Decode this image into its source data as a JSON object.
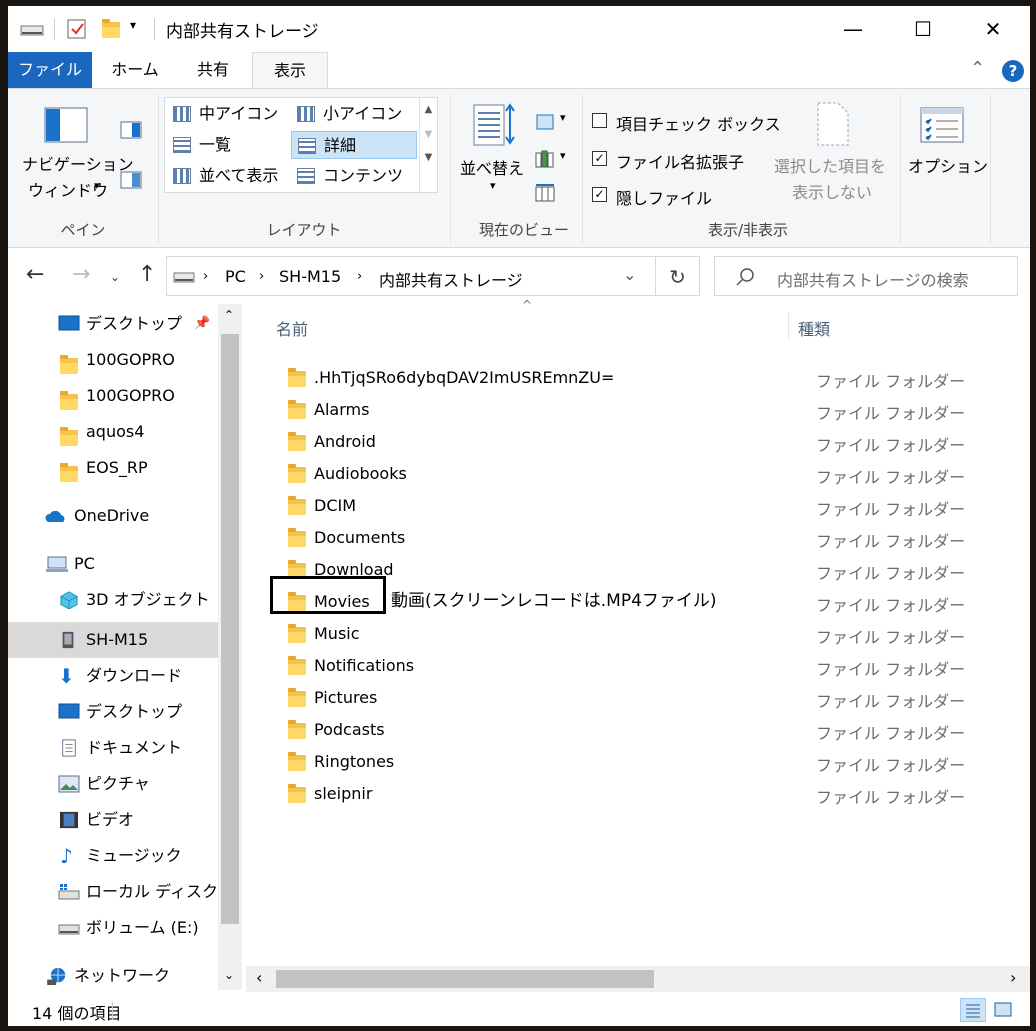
{
  "window": {
    "title": "内部共有ストレージ",
    "minimize": "—",
    "maximize": "☐",
    "close": "✕"
  },
  "ribbon": {
    "tabs": [
      "ファイル",
      "ホーム",
      "共有",
      "表示"
    ],
    "active_tab": "表示",
    "pane": {
      "nav_pane_line1": "ナビゲーション",
      "nav_pane_line2": "ウィンドウ",
      "group_label": "ペイン"
    },
    "layout": {
      "items": [
        "中アイコン",
        "小アイコン",
        "一覧",
        "詳細",
        "並べて表示",
        "コンテンツ"
      ],
      "selected": "詳細",
      "group_label": "レイアウト"
    },
    "current_view": {
      "sort_label": "並べ替え",
      "group_label": "現在のビュー"
    },
    "show_hide": {
      "item_checkboxes": "項目チェック ボックス",
      "file_extensions": "ファイル名拡張子",
      "hidden_files": "隠しファイル",
      "hide_selected_line1": "選択した項目を",
      "hide_selected_line2": "表示しない",
      "group_label": "表示/非表示"
    },
    "options_label": "オプション"
  },
  "address": {
    "crumbs": [
      "PC",
      "SH-M15",
      "内部共有ストレージ"
    ],
    "search_placeholder": "内部共有ストレージの検索"
  },
  "nav_pane": {
    "items": [
      {
        "label": "デスクトップ"
      },
      {
        "label": "100GOPRO"
      },
      {
        "label": "100GOPRO"
      },
      {
        "label": "aquos4"
      },
      {
        "label": "EOS_RP"
      },
      {
        "label": "OneDrive"
      },
      {
        "label": "PC"
      },
      {
        "label": "3D オブジェクト"
      },
      {
        "label": "SH-M15"
      },
      {
        "label": "ダウンロード"
      },
      {
        "label": "デスクトップ"
      },
      {
        "label": "ドキュメント"
      },
      {
        "label": "ピクチャ"
      },
      {
        "label": "ビデオ"
      },
      {
        "label": "ミュージック"
      },
      {
        "label": "ローカル ディスク (C"
      },
      {
        "label": "ボリューム (E:)"
      },
      {
        "label": "ネットワーク"
      }
    ],
    "selected": "SH-M15"
  },
  "file_list": {
    "columns": [
      "名前",
      "種類"
    ],
    "rows": [
      {
        "name": ".HhTjqSRo6dybqDAV2ImUSREmnZU=",
        "type": "ファイル フォルダー"
      },
      {
        "name": "Alarms",
        "type": "ファイル フォルダー"
      },
      {
        "name": "Android",
        "type": "ファイル フォルダー"
      },
      {
        "name": "Audiobooks",
        "type": "ファイル フォルダー"
      },
      {
        "name": "DCIM",
        "type": "ファイル フォルダー"
      },
      {
        "name": "Documents",
        "type": "ファイル フォルダー"
      },
      {
        "name": "Download",
        "type": "ファイル フォルダー"
      },
      {
        "name": "Movies",
        "type": "ファイル フォルダー"
      },
      {
        "name": "Music",
        "type": "ファイル フォルダー"
      },
      {
        "name": "Notifications",
        "type": "ファイル フォルダー"
      },
      {
        "name": "Pictures",
        "type": "ファイル フォルダー"
      },
      {
        "name": "Podcasts",
        "type": "ファイル フォルダー"
      },
      {
        "name": "Ringtones",
        "type": "ファイル フォルダー"
      },
      {
        "name": "sleipnir",
        "type": "ファイル フォルダー"
      }
    ],
    "annotation": "動画(スクリーンレコードは.MP4ファイル)"
  },
  "status": {
    "item_count": "14 個の項目"
  },
  "colors": {
    "file_tab": "#1a67c0",
    "selection": "#cce4f7",
    "folder": "#ffd865"
  }
}
